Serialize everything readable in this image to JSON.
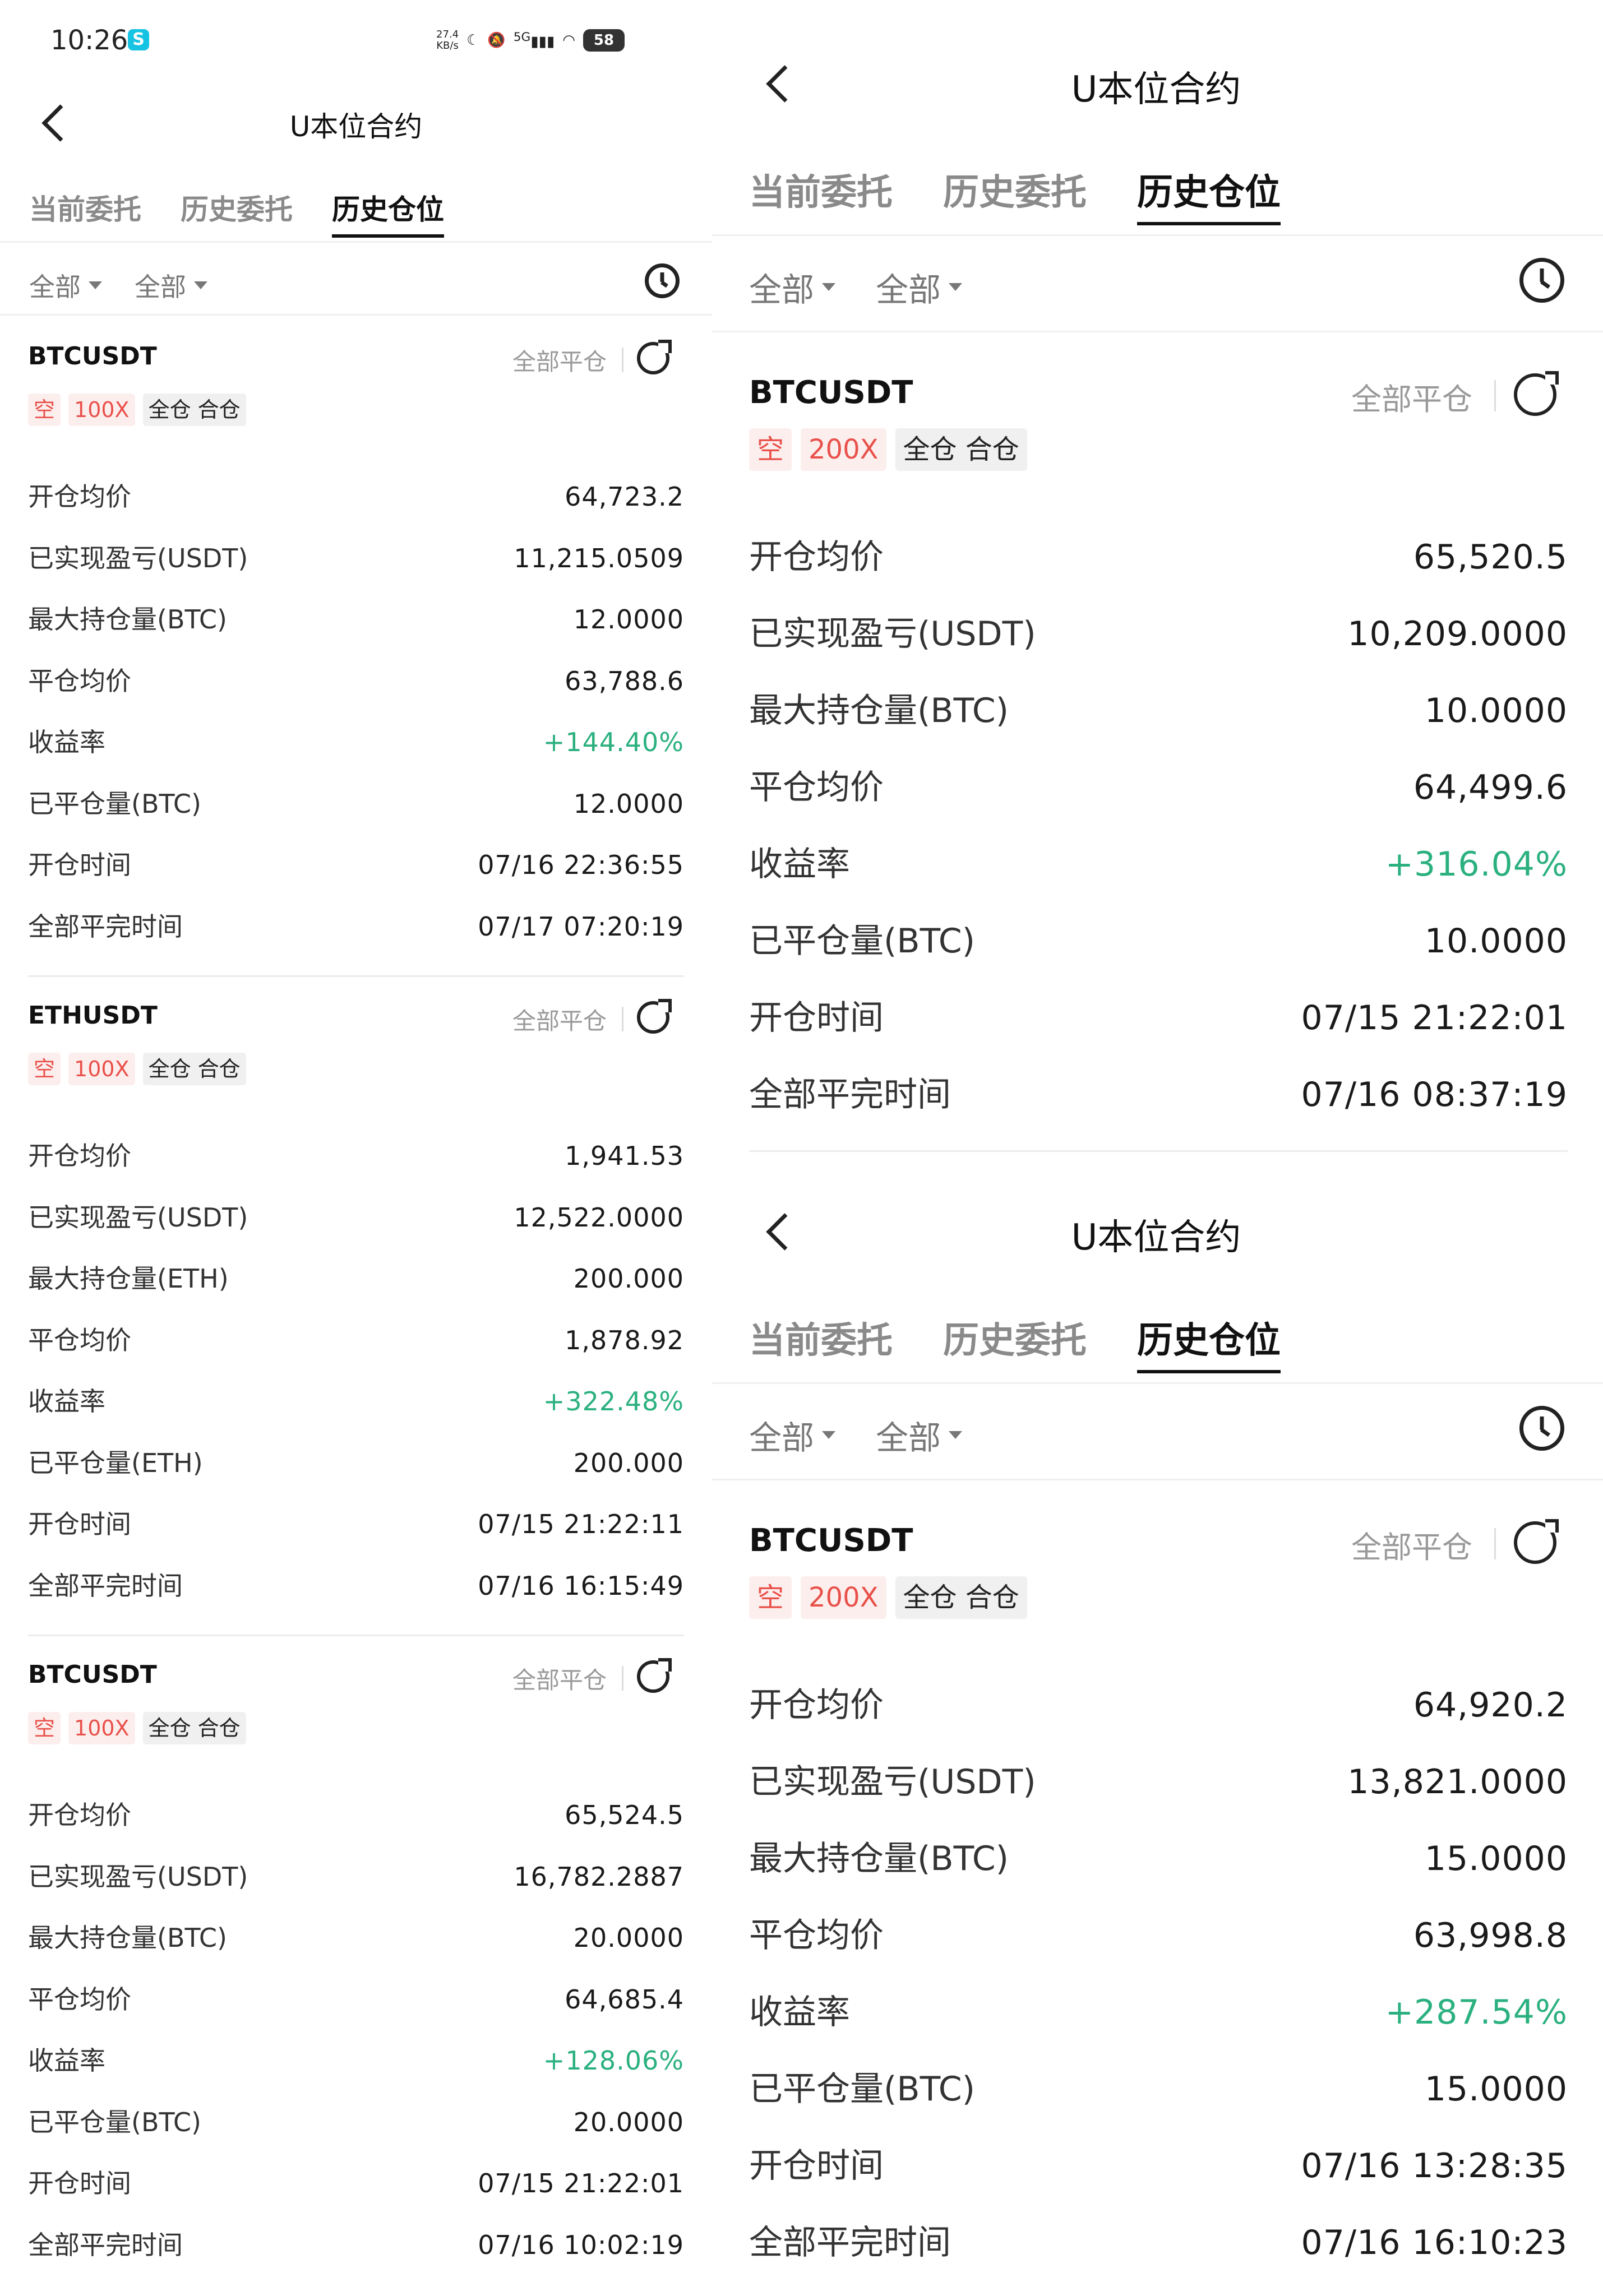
{
  "status_bar": {
    "time": "10:26",
    "net_speed": "27.4",
    "net_unit": "KB/s",
    "signal": "5G",
    "battery": "58"
  },
  "header": {
    "title": "U本位合约",
    "tabs": [
      "当前委托",
      "历史委托",
      "历史仓位"
    ],
    "active_tab": 2,
    "filters": [
      "全部",
      "全部"
    ]
  },
  "close_all_label": "全部平仓",
  "field_labels": {
    "open_avg": "开仓均价",
    "realized_pnl": "已实现盈亏(USDT)",
    "max_pos": "最大持仓量",
    "close_avg": "平仓均价",
    "roi": "收益率",
    "closed_qty": "已平仓量",
    "open_time": "开仓时间",
    "close_time": "全部平完时间"
  },
  "left_positions": [
    {
      "symbol": "BTCUSDT",
      "side": "空",
      "leverage": "100X",
      "margin": "全仓 合仓",
      "labels": [
        "开仓均价",
        "已实现盈亏(USDT)",
        "最大持仓量(BTC)",
        "平仓均价",
        "收益率",
        "已平仓量(BTC)",
        "开仓时间",
        "全部平完时间"
      ],
      "values": [
        "64,723.2",
        "11,215.0509",
        "12.0000",
        "63,788.6",
        "+144.40%",
        "12.0000",
        "07/16 22:36:55",
        "07/17 07:20:19"
      ]
    },
    {
      "symbol": "ETHUSDT",
      "side": "空",
      "leverage": "100X",
      "margin": "全仓 合仓",
      "labels": [
        "开仓均价",
        "已实现盈亏(USDT)",
        "最大持仓量(ETH)",
        "平仓均价",
        "收益率",
        "已平仓量(ETH)",
        "开仓时间",
        "全部平完时间"
      ],
      "values": [
        "1,941.53",
        "12,522.0000",
        "200.000",
        "1,878.92",
        "+322.48%",
        "200.000",
        "07/15 21:22:11",
        "07/16 16:15:49"
      ]
    },
    {
      "symbol": "BTCUSDT",
      "side": "空",
      "leverage": "100X",
      "margin": "全仓 合仓",
      "labels": [
        "开仓均价",
        "已实现盈亏(USDT)",
        "最大持仓量(BTC)",
        "平仓均价",
        "收益率",
        "已平仓量(BTC)",
        "开仓时间",
        "全部平完时间"
      ],
      "values": [
        "65,524.5",
        "16,782.2887",
        "20.0000",
        "64,685.4",
        "+128.06%",
        "20.0000",
        "07/15 21:22:01",
        "07/16 10:02:19"
      ]
    }
  ],
  "right_positions": [
    {
      "symbol": "BTCUSDT",
      "side": "空",
      "leverage": "200X",
      "margin": "全仓 合仓",
      "labels": [
        "开仓均价",
        "已实现盈亏(USDT)",
        "最大持仓量(BTC)",
        "平仓均价",
        "收益率",
        "已平仓量(BTC)",
        "开仓时间",
        "全部平完时间"
      ],
      "values": [
        "65,520.5",
        "10,209.0000",
        "10.0000",
        "64,499.6",
        "+316.04%",
        "10.0000",
        "07/15 21:22:01",
        "07/16 08:37:19"
      ]
    },
    {
      "symbol": "BTCUSDT",
      "side": "空",
      "leverage": "200X",
      "margin": "全仓 合仓",
      "labels": [
        "开仓均价",
        "已实现盈亏(USDT)",
        "最大持仓量(BTC)",
        "平仓均价",
        "收益率",
        "已平仓量(BTC)",
        "开仓时间",
        "全部平完时间"
      ],
      "values": [
        "64,920.2",
        "13,821.0000",
        "15.0000",
        "63,998.8",
        "+287.54%",
        "15.0000",
        "07/16 13:28:35",
        "07/16 16:10:23"
      ]
    }
  ],
  "colors": {
    "positive": "#2bb07f",
    "short_tag_text": "#e8514a",
    "short_tag_bg": "#fdeeee"
  }
}
